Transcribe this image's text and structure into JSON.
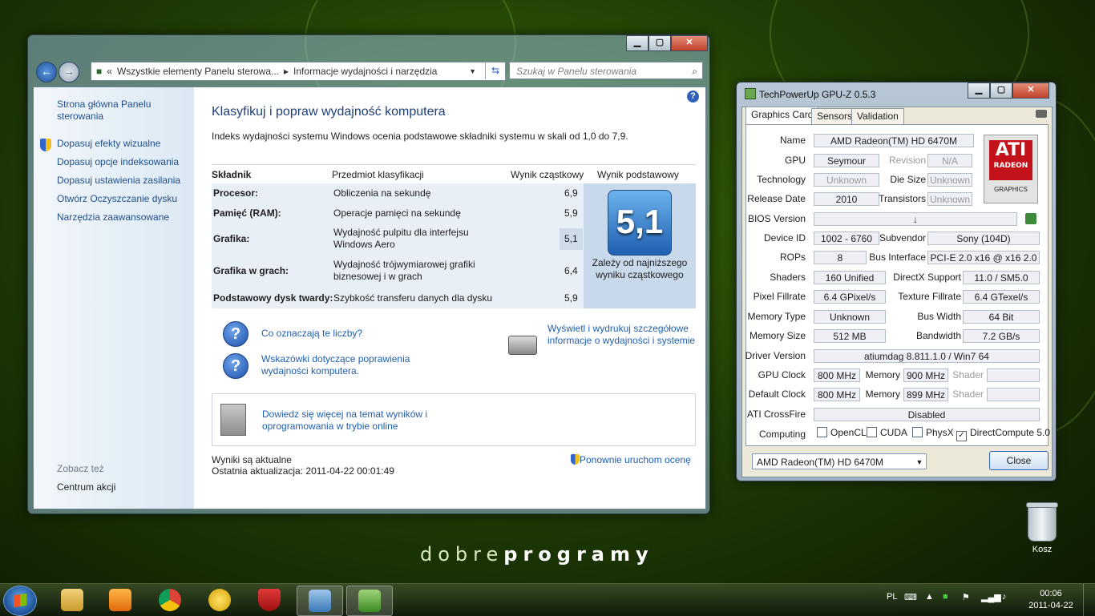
{
  "desktop": {
    "brand_light": "dobre",
    "brand_bold": "programy",
    "recycle_bin_label": "Kosz"
  },
  "control_panel": {
    "caption": {
      "minimize": "▁",
      "maximize": "▢",
      "close": "✕"
    },
    "breadcrumb": [
      "«",
      "Wszystkie elementy Panelu sterowa...",
      "▸",
      "Informacje wydajności i narzędzia"
    ],
    "search_placeholder": "Szukaj w Panelu sterowania",
    "sidebar": {
      "home": "Strona główna Panelu sterowania",
      "links": [
        "Dopasuj efekty wizualne",
        "Dopasuj opcje indeksowania",
        "Dopasuj ustawienia zasilania",
        "Otwórz Oczyszczanie dysku",
        "Narzędzia zaawansowane"
      ],
      "see_also_heading": "Zobacz też",
      "see_also_links": [
        "Centrum akcji"
      ]
    },
    "title": "Klasyfikuj i popraw wydajność komputera",
    "description": "Indeks wydajności systemu Windows ocenia podstawowe składniki systemu w skali od 1,0 do 7,9.",
    "table": {
      "headers": [
        "Składnik",
        "Przedmiot klasyfikacji",
        "Wynik cząstkowy",
        "Wynik podstawowy"
      ],
      "rows": [
        {
          "component": "Procesor:",
          "subject": "Obliczenia na sekundę",
          "score": "6,9"
        },
        {
          "component": "Pamięć (RAM):",
          "subject": "Operacje pamięci na sekundę",
          "score": "5,9"
        },
        {
          "component": "Grafika:",
          "subject": "Wydajność pulpitu dla interfejsu Windows Aero",
          "score": "5,1"
        },
        {
          "component": "Grafika w grach:",
          "subject": "Wydajność trójwymiarowej grafiki biznesowej i w grach",
          "score": "6,4"
        },
        {
          "component": "Podstawowy dysk twardy:",
          "subject": "Szybkość transferu danych dla dysku",
          "score": "5,9"
        }
      ],
      "base_score": "5,1",
      "base_note": "Zależy od najniższego wyniku cząstkowego"
    },
    "links": {
      "what_mean": "Co oznaczają te liczby?",
      "tips": "Wskazówki dotyczące poprawienia wydajności komputera.",
      "print": "Wyświetl i wydrukuj szczegółowe informacje o wydajności i systemie",
      "learn_more": "Dowiedz się więcej na temat wyników i oprogramowania w trybie online",
      "rerun": "Ponownie uruchom ocenę"
    },
    "status": {
      "current": "Wyniki są aktualne",
      "last_update": "Ostatnia aktualizacja: 2011-04-22 00:01:49"
    }
  },
  "gpuz": {
    "title": "TechPowerUp GPU-Z 0.5.3",
    "tabs": [
      "Graphics Card",
      "Sensors",
      "Validation"
    ],
    "fields": {
      "name_label": "Name",
      "name": "AMD Radeon(TM) HD 6470M",
      "gpu_label": "GPU",
      "gpu": "Seymour",
      "revision_label": "Revision",
      "revision": "N/A",
      "technology_label": "Technology",
      "technology": "Unknown",
      "die_size_label": "Die Size",
      "die_size": "Unknown",
      "release_label": "Release Date",
      "release": "2010",
      "transistors_label": "Transistors",
      "transistors": "Unknown",
      "bios_label": "BIOS Version",
      "bios": "↓",
      "device_id_label": "Device ID",
      "device_id": "1002 - 6760",
      "subvendor_label": "Subvendor",
      "subvendor": "Sony (104D)",
      "rops_label": "ROPs",
      "rops": "8",
      "bus_label": "Bus Interface",
      "bus": "PCI-E 2.0 x16 @ x16 2.0",
      "shaders_label": "Shaders",
      "shaders": "160 Unified",
      "directx_label": "DirectX Support",
      "directx": "11.0 / SM5.0",
      "pixel_label": "Pixel Fillrate",
      "pixel": "6.4 GPixel/s",
      "texture_label": "Texture Fillrate",
      "texture": "6.4 GTexel/s",
      "memtype_label": "Memory Type",
      "memtype": "Unknown",
      "buswidth_label": "Bus Width",
      "buswidth": "64 Bit",
      "memsize_label": "Memory Size",
      "memsize": "512 MB",
      "bandwidth_label": "Bandwidth",
      "bandwidth": "7.2 GB/s",
      "driver_label": "Driver Version",
      "driver": "atiumdag 8.811.1.0 / Win7 64",
      "gpuclock_label": "GPU Clock",
      "gpuclock": "800 MHz",
      "memory_label": "Memory",
      "memclock": "900 MHz",
      "shader_label": "Shader",
      "shaderclock": "",
      "defclock_label": "Default Clock",
      "defclock": "800 MHz",
      "defmem": "899 MHz",
      "defshader": "",
      "crossfire_label": "ATI CrossFire",
      "crossfire": "Disabled",
      "computing_label": "Computing"
    },
    "computing": [
      {
        "label": "OpenCL",
        "checked": false
      },
      {
        "label": "CUDA",
        "checked": false
      },
      {
        "label": "PhysX",
        "checked": false
      },
      {
        "label": "DirectCompute 5.0",
        "checked": true
      }
    ],
    "logo_text": "ATI",
    "logo_sub": "RADEON",
    "logo_sub2": "GRAPHICS",
    "selected_card": "AMD Radeon(TM) HD 6470M",
    "close_label": "Close"
  },
  "taskbar": {
    "language": "PL",
    "clock_time": "00:06",
    "clock_date": "2011-04-22",
    "pinned": [
      "explorer",
      "media-player",
      "chrome",
      "transfer",
      "mcafee",
      "control-panel",
      "gpu-z"
    ]
  }
}
